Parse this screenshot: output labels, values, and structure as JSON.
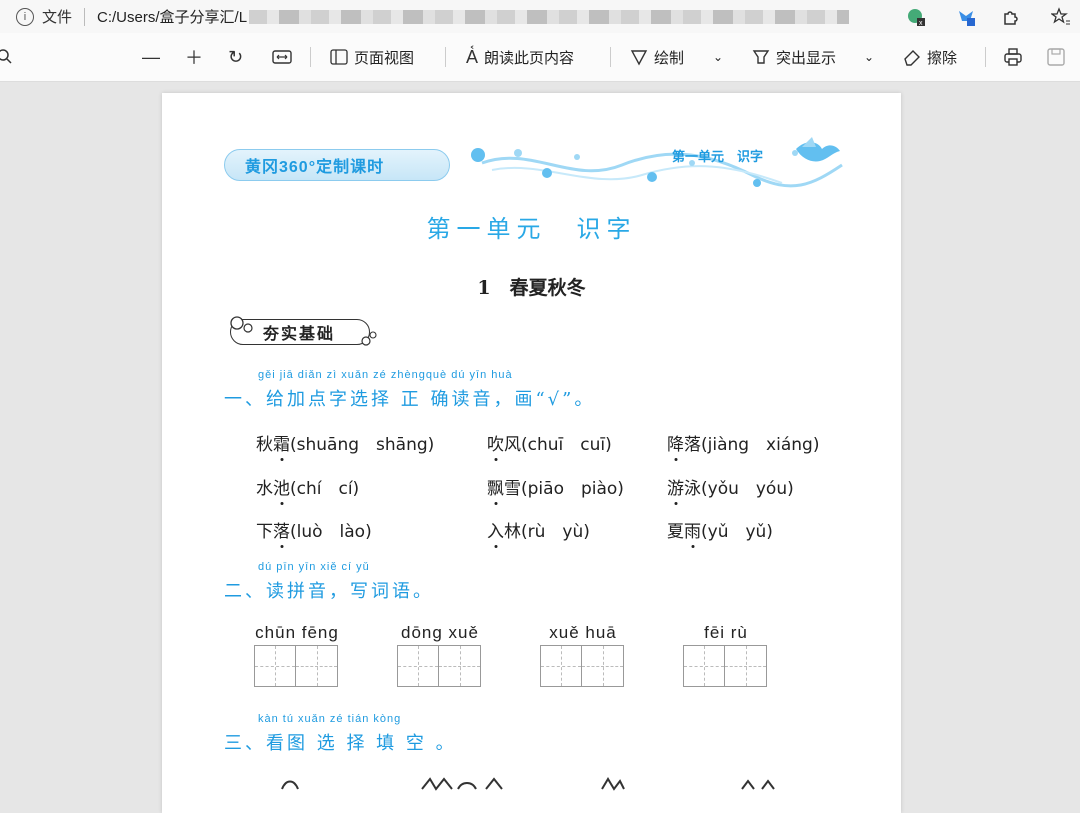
{
  "browser": {
    "file_label": "文件",
    "url": "C:/Users/盒子分享汇/L"
  },
  "toolbar": {
    "page_view": "页面视图",
    "read_aloud": "朗读此页内容",
    "draw": "绘制",
    "highlight": "突出显示",
    "erase": "擦除"
  },
  "doc": {
    "banner": "黄冈360°定制课时",
    "unit_tag": "第一单元　识字",
    "unit_title": "第一单元　识字",
    "lesson_title": "1　春夏秋冬",
    "section_tag": "夯实基础",
    "q1": {
      "pinyin": "gěi jiā diǎn zì xuǎn zé zhèngquè dú yīn  huà",
      "text": "一、给加点字选择 正 确读音，画“√”。",
      "items": [
        {
          "chars": "秋霜",
          "dot": "霜",
          "opts": "(shuāng　shāng)"
        },
        {
          "chars": "吹风",
          "dot": "吹",
          "opts": "(chuī　cuī)"
        },
        {
          "chars": "降落",
          "dot": "降",
          "opts": "(jiàng　xiáng)"
        },
        {
          "chars": "水池",
          "dot": "池",
          "opts": "(chí　cí)"
        },
        {
          "chars": "飘雪",
          "dot": "飘",
          "opts": "(piāo　piào)"
        },
        {
          "chars": "游泳",
          "dot": "游",
          "opts": "(yǒu　yóu)"
        },
        {
          "chars": "下落",
          "dot": "落",
          "opts": "(luò　lào)"
        },
        {
          "chars": "入林",
          "dot": "入",
          "opts": "(rù　yù)"
        },
        {
          "chars": "夏雨",
          "dot": "雨",
          "opts": "(yǔ　yǔ)"
        }
      ]
    },
    "q2": {
      "pinyin": "dú pīn yīn   xiě cí  yǔ",
      "text": "二、读拼音，写词语。",
      "words": [
        "chūn fēng",
        "dōng xuě",
        "xuě  huā",
        "fēi   rù"
      ]
    },
    "q3": {
      "pinyin": "kàn tú xuǎn zé tián kòng",
      "text": "三、看图 选 择 填 空 。"
    }
  },
  "colors": {
    "accent": "#1f9be0",
    "title": "#29a8e6"
  }
}
